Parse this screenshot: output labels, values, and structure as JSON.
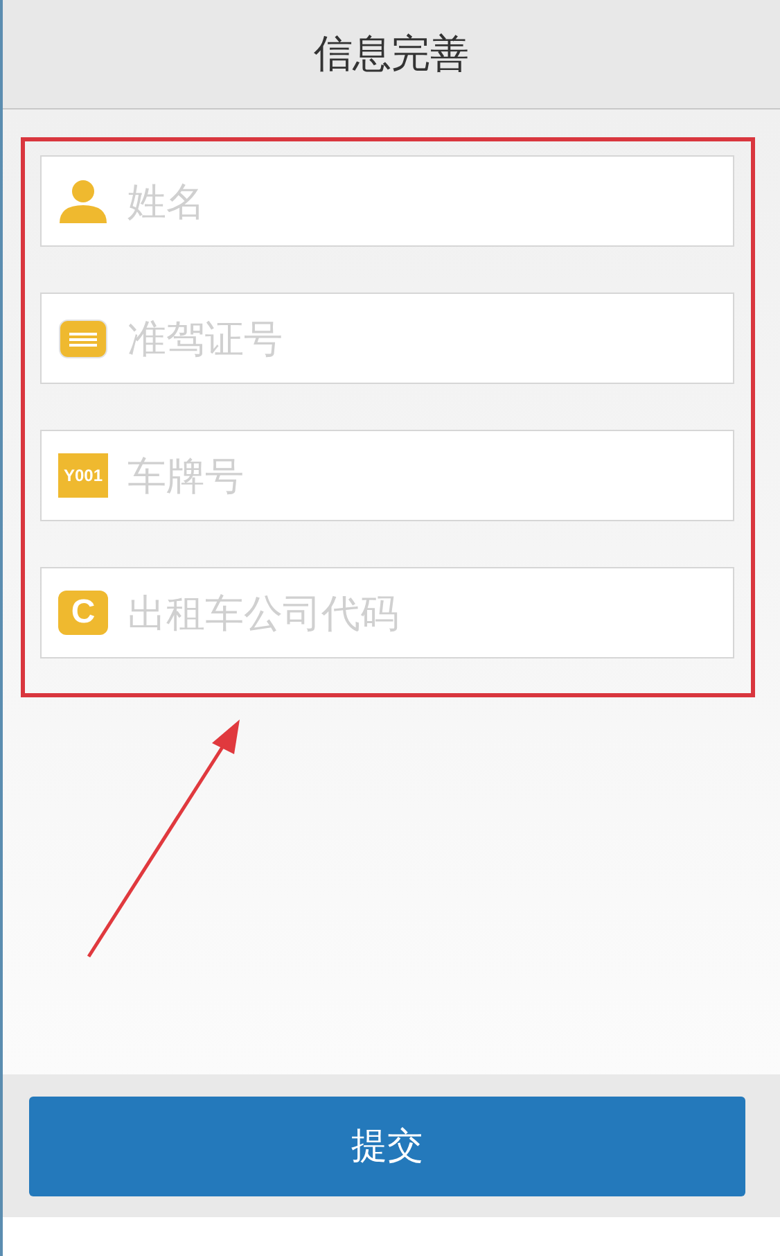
{
  "header": {
    "title": "信息完善"
  },
  "fields": [
    {
      "kind": "person",
      "placeholder": "姓名"
    },
    {
      "kind": "card",
      "placeholder": "准驾证号"
    },
    {
      "kind": "plate",
      "icon_text": "Y001",
      "placeholder": "车牌号"
    },
    {
      "kind": "letter",
      "icon_text": "C",
      "placeholder": "出租车公司代码"
    }
  ],
  "annotation": {
    "highlight": true,
    "arrow": true
  },
  "submit_button": {
    "label": "提交"
  }
}
